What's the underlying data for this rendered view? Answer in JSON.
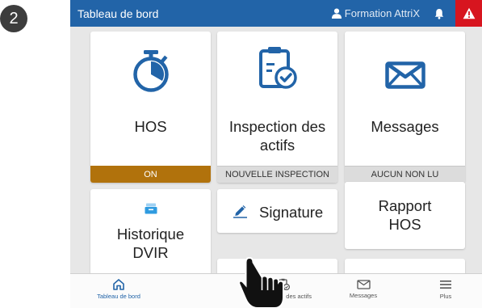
{
  "step": {
    "number": "2"
  },
  "header": {
    "title": "Tableau de bord",
    "user": "Formation AttriX",
    "color": "#2264a8",
    "alert_color": "#d7151f"
  },
  "tiles": {
    "hos": {
      "label": "HOS",
      "status": "ON",
      "icon": "stopwatch-icon"
    },
    "inspection": {
      "label_line1": "Inspection des",
      "label_line2": "actifs",
      "status": "NOUVELLE INSPECTION",
      "icon": "clipboard-check-icon"
    },
    "messages": {
      "label": "Messages",
      "status": "AUCUN NON LU",
      "icon": "envelope-icon"
    },
    "dvir": {
      "label_line1": "Historique",
      "label_line2": "DVIR",
      "icon": "file-box-icon"
    },
    "signature": {
      "label": "Signature",
      "icon": "pen-signature-icon"
    },
    "rapport": {
      "label_line1": "Rapport",
      "label_line2": "HOS"
    }
  },
  "tabbar": {
    "items": [
      {
        "label": "Tableau de bord",
        "icon": "home-icon",
        "active": true
      },
      {
        "label": "Inspection des actifs",
        "icon": "clipboard-check-icon",
        "active": false
      },
      {
        "label": "Messages",
        "icon": "envelope-icon",
        "active": false
      },
      {
        "label": "Plus",
        "icon": "menu-icon",
        "active": false
      }
    ]
  },
  "colors": {
    "on_status": "#b1720c",
    "accent": "#2264a8"
  }
}
